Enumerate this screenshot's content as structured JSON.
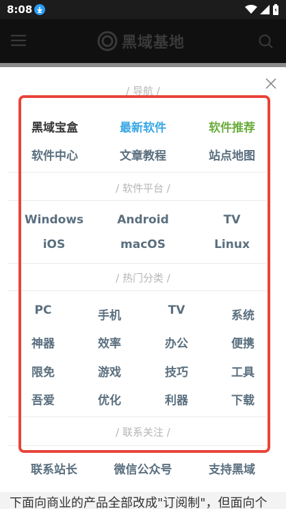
{
  "status": {
    "time": "8:08"
  },
  "header": {
    "logo_text": "黑域基地"
  },
  "menu": {
    "nav_title": "/ 导航 /",
    "nav_items": [
      {
        "label": "黑域宝盒",
        "color": "#333333"
      },
      {
        "label": "最新软件",
        "color": "#3aa7e6"
      },
      {
        "label": "软件推荐",
        "color": "#6aad3c"
      },
      {
        "label": "软件中心",
        "color": "#5a6f7f"
      },
      {
        "label": "文章教程",
        "color": "#5a6f7f"
      },
      {
        "label": "站点地图",
        "color": "#5a6f7f"
      }
    ],
    "platform_title": "/ 软件平台 /",
    "platforms": [
      "Windows",
      "Android",
      "TV",
      "iOS",
      "macOS",
      "Linux"
    ],
    "category_title": "/ 热门分类 /",
    "categories": [
      "PC",
      "手机",
      "TV",
      "系统",
      "神器",
      "效率",
      "办公",
      "便携",
      "限免",
      "游戏",
      "技巧",
      "工具",
      "吾爱",
      "优化",
      "利器",
      "下载"
    ],
    "contact_title": "/ 联系关注 /",
    "contacts": [
      "联系站长",
      "微信公众号",
      "支持黑域"
    ]
  },
  "footer_text": "下面向商业的产品全部改成\"订阅制\"，但面向个"
}
